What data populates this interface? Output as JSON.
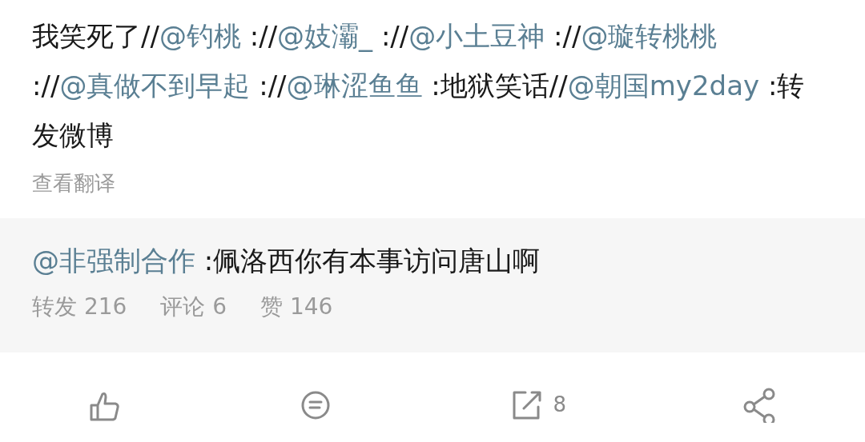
{
  "post": {
    "segments": [
      {
        "kind": "text",
        "text": "我笑死了//"
      },
      {
        "kind": "mention",
        "text": "@钓桃"
      },
      {
        "kind": "text",
        "text": " ://"
      },
      {
        "kind": "mention",
        "text": "@妓灞_"
      },
      {
        "kind": "text",
        "text": " ://"
      },
      {
        "kind": "mention",
        "text": "@小土豆神"
      },
      {
        "kind": "text",
        "text": " ://"
      },
      {
        "kind": "mention",
        "text": "@璇转桃桃"
      },
      {
        "kind": "text",
        "text": " ://"
      },
      {
        "kind": "mention",
        "text": "@真做不到早起"
      },
      {
        "kind": "text",
        "text": " ://"
      },
      {
        "kind": "mention",
        "text": "@琳涩鱼鱼"
      },
      {
        "kind": "text",
        "text": " :地狱笑话//"
      },
      {
        "kind": "mention",
        "text": "@朝国my2day"
      },
      {
        "kind": "text",
        "text": " :转发微博"
      }
    ],
    "translate": "查看翻译"
  },
  "original": {
    "author": "@非强制合作",
    "text": " :佩洛西你有本事访问唐山啊",
    "stats": [
      {
        "label": "转发",
        "count": "216"
      },
      {
        "label": "评论",
        "count": "6"
      },
      {
        "label": "赞",
        "count": "146"
      }
    ]
  },
  "actions": [
    {
      "kind": "like"
    },
    {
      "kind": "comment"
    },
    {
      "kind": "repost",
      "count": "8"
    },
    {
      "kind": "share"
    }
  ]
}
